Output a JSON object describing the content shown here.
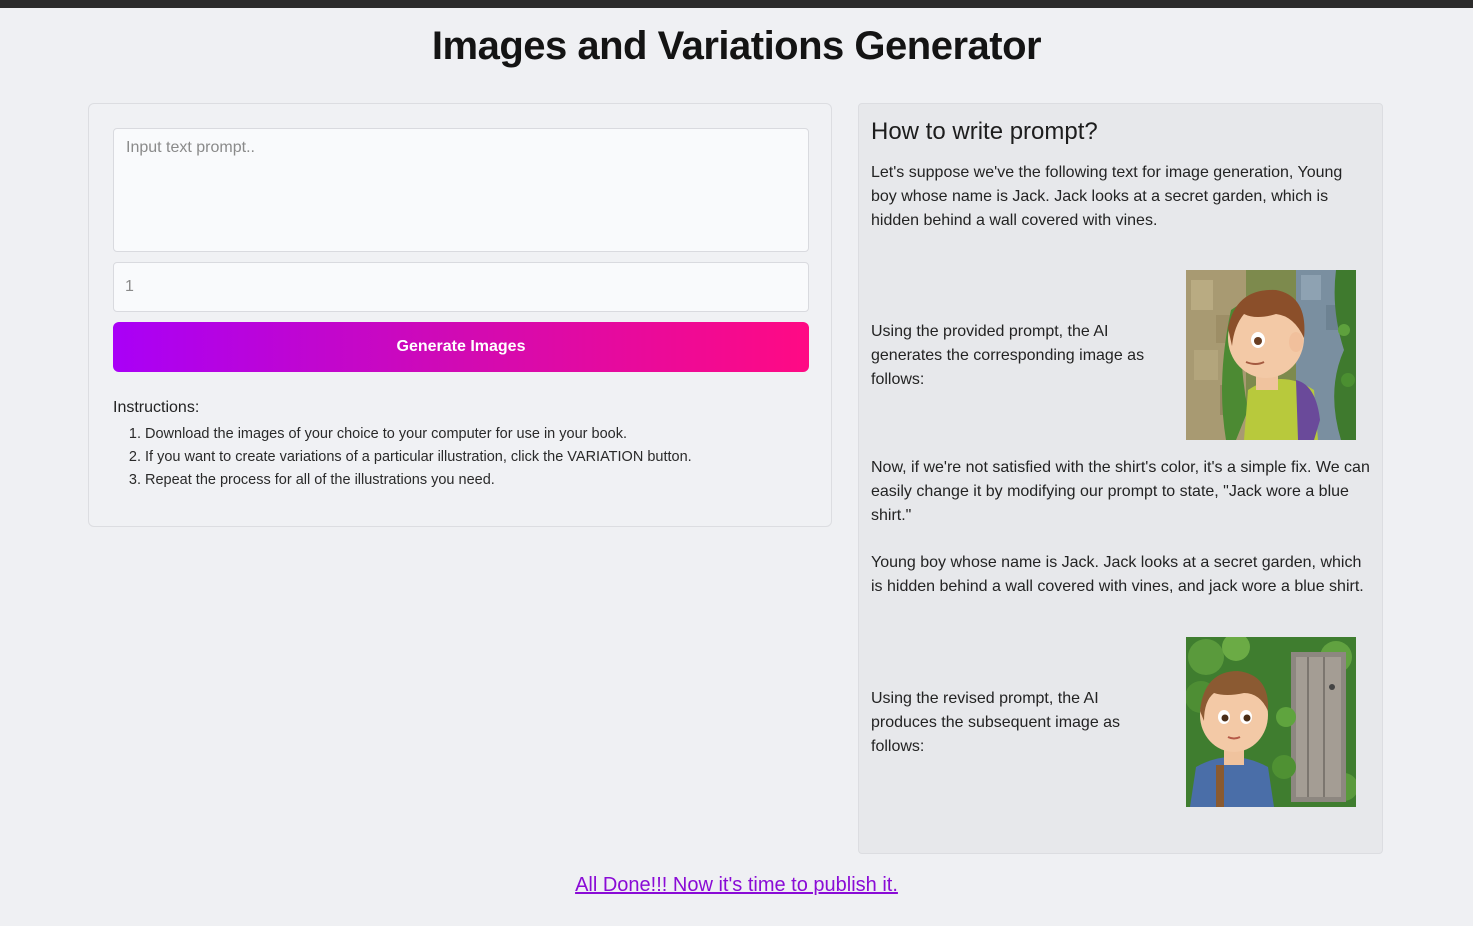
{
  "header": {
    "title": "Images and Variations Generator"
  },
  "form": {
    "prompt_placeholder": "Input text prompt..",
    "count_placeholder": "1",
    "generate_label": "Generate Images"
  },
  "instructions": {
    "title": "Instructions:",
    "items": [
      "Download the images of your choice to your computer for use in your book.",
      "If you want to create variations of a particular illustration, click the VARIATION button.",
      "Repeat the process for all of the illustrations you need."
    ]
  },
  "guide": {
    "title": "How to write prompt?",
    "intro": "Let's suppose we've the following text for image generation, Young boy whose name is Jack. Jack looks at a secret garden, which is hidden behind a wall covered with vines.",
    "first_result": "Using the provided prompt, the AI generates the corresponding image as follows:",
    "change_note": "Now, if we're not satisfied with the shirt's color, it's a simple fix. We can easily change it by modifying our prompt to state, \"Jack wore a blue shirt.\"",
    "revised_prompt": "Young boy whose name is Jack. Jack looks at a secret garden, which is hidden behind a wall covered with vines, and jack wore a blue shirt.",
    "second_result": "Using the revised prompt, the AI produces the subsequent image as follows:"
  },
  "footer": {
    "publish_link": "All Done!!! Now it's time to publish it."
  },
  "colors": {
    "button_start": "#a900f7",
    "button_end": "#ff0a84",
    "link": "#8a0bd6"
  }
}
